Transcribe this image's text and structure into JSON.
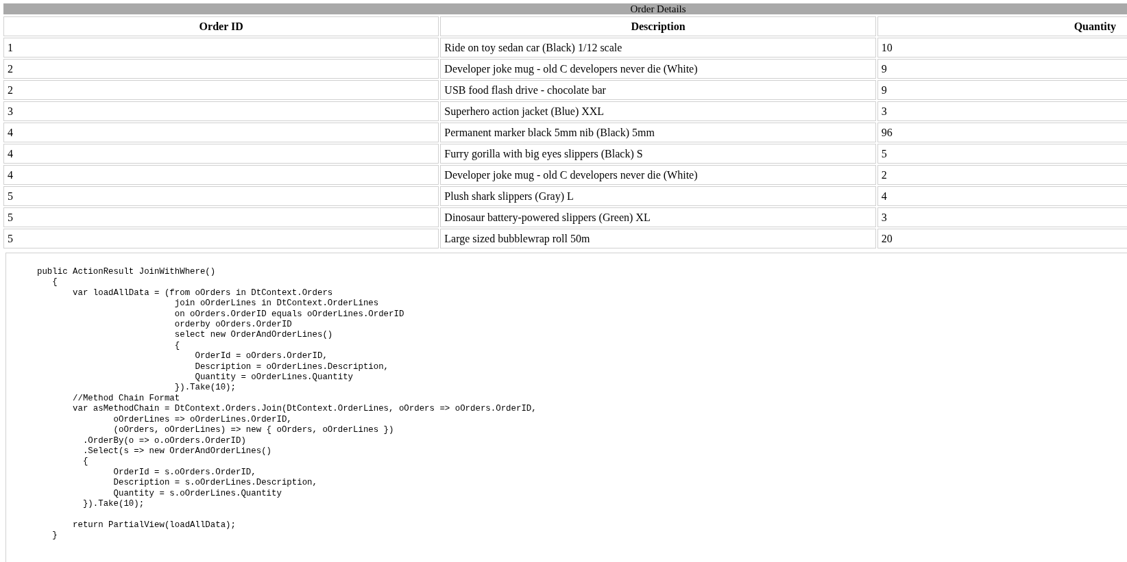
{
  "table": {
    "caption": "Order Details",
    "columns": [
      "Order ID",
      "Description",
      "Quantity"
    ],
    "rows": [
      [
        "1",
        "Ride on toy sedan car (Black) 1/12 scale",
        "10"
      ],
      [
        "2",
        "Developer joke mug - old C developers never die (White)",
        "9"
      ],
      [
        "2",
        "USB food flash drive - chocolate bar",
        "9"
      ],
      [
        "3",
        "Superhero action jacket (Blue) XXL",
        "3"
      ],
      [
        "4",
        "Permanent marker black 5mm nib (Black) 5mm",
        "96"
      ],
      [
        "4",
        "Furry gorilla with big eyes slippers (Black) S",
        "5"
      ],
      [
        "4",
        "Developer joke mug - old C developers never die (White)",
        "2"
      ],
      [
        "5",
        "Plush shark slippers (Gray) L",
        "4"
      ],
      [
        "5",
        "Dinosaur battery-powered slippers (Green) XL",
        "3"
      ],
      [
        "5",
        "Large sized bubblewrap roll 50m",
        "20"
      ]
    ]
  },
  "code": "public ActionResult JoinWithWhere()\n   {\n       var loadAllData = (from oOrders in DtContext.Orders\n                           join oOrderLines in DtContext.OrderLines\n                           on oOrders.OrderID equals oOrderLines.OrderID\n                           orderby oOrders.OrderID\n                           select new OrderAndOrderLines()\n                           {\n                               OrderId = oOrders.OrderID,\n                               Description = oOrderLines.Description,\n                               Quantity = oOrderLines.Quantity\n                           }).Take(10);\n       //Method Chain Format\n       var asMethodChain = DtContext.Orders.Join(DtContext.OrderLines, oOrders => oOrders.OrderID,\n               oOrderLines => oOrderLines.OrderID,\n               (oOrders, oOrderLines) => new { oOrders, oOrderLines })\n         .OrderBy(o => o.oOrders.OrderID)\n         .Select(s => new OrderAndOrderLines()\n         {\n               OrderId = s.oOrders.OrderID,\n               Description = s.oOrderLines.Description,\n               Quantity = s.oOrderLines.Quantity\n         }).Take(10);\n\n       return PartialView(loadAllData);\n   }"
}
